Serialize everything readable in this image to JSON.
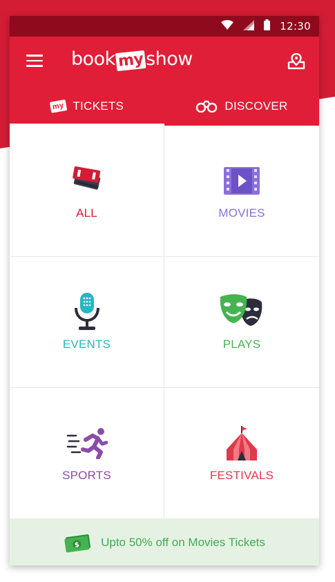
{
  "status_bar": {
    "time": "12:30"
  },
  "header": {
    "logo_prefix": "book",
    "logo_my": "my",
    "logo_suffix": "show"
  },
  "tabs": [
    {
      "badge": "my",
      "label": "TICKETS",
      "active": true
    },
    {
      "label": "DISCOVER",
      "active": false
    }
  ],
  "categories": [
    {
      "label": "ALL",
      "color": "#d31d35",
      "icon": "ticket-icon"
    },
    {
      "label": "MOVIES",
      "color": "#8a6fde",
      "icon": "film-icon"
    },
    {
      "label": "EVENTS",
      "color": "#29b5c3",
      "icon": "microphone-icon"
    },
    {
      "label": "PLAYS",
      "color": "#46b351",
      "icon": "theatre-masks-icon"
    },
    {
      "label": "SPORTS",
      "color": "#8b4ca8",
      "icon": "runner-icon"
    },
    {
      "label": "FESTIVALS",
      "color": "#e0394a",
      "icon": "circus-tent-icon"
    }
  ],
  "offer": {
    "text": "Upto 50% off on Movies Tickets",
    "icon": "cash-icon"
  },
  "colors": {
    "brand": "#e01e37",
    "status_bar": "#8f0a1c",
    "offer_bg": "#e5f2e3"
  }
}
